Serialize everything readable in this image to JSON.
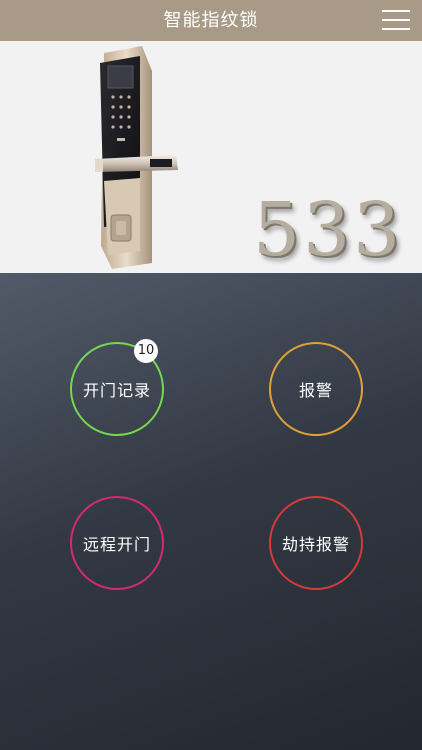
{
  "header": {
    "title": "智能指纹锁"
  },
  "hero": {
    "room_number": "533"
  },
  "actions": {
    "open_records": {
      "label": "开门记录",
      "badge_count": "10",
      "color": "#76d94f"
    },
    "alarm": {
      "label": "报警",
      "color": "#e0a237"
    },
    "remote_open": {
      "label": "远程开门",
      "color": "#d52a6e"
    },
    "duress_alarm": {
      "label": "劫持报警",
      "color": "#d73a3a"
    }
  }
}
